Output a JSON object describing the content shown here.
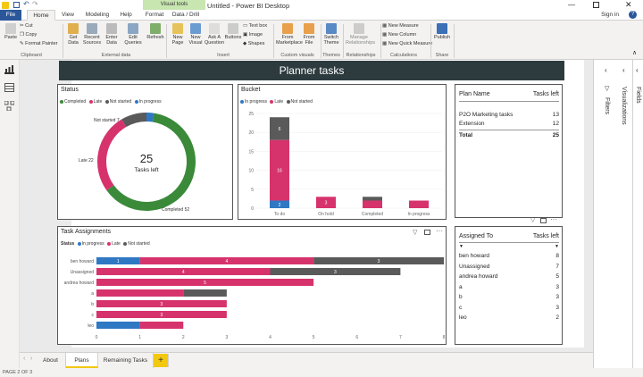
{
  "window": {
    "title": "Untitled - Power BI Desktop",
    "context_tab": "Visual tools",
    "sign_in": "Sign in"
  },
  "tabs": [
    "File",
    "Home",
    "View",
    "Modeling",
    "Help",
    "Format",
    "Data / Drill"
  ],
  "ribbon": {
    "clipboard": {
      "paste": "Paste",
      "cut": "Cut",
      "copy": "Copy",
      "format_painter": "Format Painter",
      "group": "Clipboard"
    },
    "external": {
      "get_data": "Get Data",
      "recent_sources": "Recent Sources",
      "enter_data": "Enter Data",
      "edit_queries": "Edit Queries",
      "refresh": "Refresh",
      "group": "External data"
    },
    "insert": {
      "new_page": "New Page",
      "new_visual": "New Visual",
      "ask": "Ask A Question",
      "buttons": "Buttons",
      "text_box": "Text box",
      "image": "Image",
      "shapes": "Shapes",
      "group": "Insert"
    },
    "custom": {
      "marketplace": "From Marketplace",
      "file": "From File",
      "group": "Custom visuals"
    },
    "themes": {
      "switch": "Switch Theme",
      "group": "Themes"
    },
    "relationships": {
      "manage": "Manage Relationships",
      "group": "Relationships"
    },
    "calculations": {
      "measure": "New Measure",
      "column": "New Column",
      "quick": "New Quick Measure",
      "group": "Calculations"
    },
    "share": {
      "publish": "Publish",
      "group": "Share"
    }
  },
  "report": {
    "title": "Planner tasks"
  },
  "status_chart": {
    "title": "Status",
    "legend": [
      {
        "name": "Completed",
        "color": "#3a8a3a"
      },
      {
        "name": "Late",
        "color": "#d6336c"
      },
      {
        "name": "Not started",
        "color": "#5a5a5a"
      },
      {
        "name": "In progress",
        "color": "#2f78c4"
      }
    ],
    "center_value": "25",
    "center_label": "Tasks left",
    "labels": {
      "not_started": "Not started 7",
      "late": "Late 22",
      "completed": "Completed 52"
    }
  },
  "bucket_chart": {
    "title": "Bucket",
    "legend": [
      {
        "name": "In progress",
        "color": "#2f78c4"
      },
      {
        "name": "Late",
        "color": "#d6336c"
      },
      {
        "name": "Not started",
        "color": "#5a5a5a"
      }
    ]
  },
  "assign_chart": {
    "title": "Task Assignments",
    "legend_prefix": "Status",
    "legend": [
      {
        "name": "In progress",
        "color": "#2f78c4"
      },
      {
        "name": "Late",
        "color": "#d6336c"
      },
      {
        "name": "Not started",
        "color": "#5a5a5a"
      }
    ]
  },
  "chart_data": [
    {
      "type": "pie",
      "title": "Status",
      "categories": [
        "Completed",
        "Late",
        "Not started",
        "In progress"
      ],
      "values": [
        52,
        22,
        7,
        2
      ],
      "colors": [
        "#3a8a3a",
        "#d6336c",
        "#5a5a5a",
        "#2f78c4"
      ]
    },
    {
      "type": "bar",
      "title": "Bucket",
      "stacked": true,
      "categories": [
        "To do",
        "On hold",
        "Completed",
        "In progress"
      ],
      "series": [
        {
          "name": "In progress",
          "values": [
            2,
            0,
            0,
            0
          ],
          "color": "#2f78c4"
        },
        {
          "name": "Late",
          "values": [
            16,
            3,
            2,
            2
          ],
          "color": "#d6336c"
        },
        {
          "name": "Not started",
          "values": [
            6,
            0,
            1,
            0
          ],
          "color": "#5a5a5a"
        }
      ],
      "ylim": [
        0,
        25
      ],
      "yticks": [
        0,
        5,
        10,
        15,
        20,
        25
      ],
      "segment_labels": [
        [
          "2",
          "16",
          "6"
        ],
        [
          "",
          "3",
          ""
        ],
        [
          "",
          "",
          ""
        ],
        [
          "",
          "",
          ""
        ]
      ]
    },
    {
      "type": "bar",
      "orientation": "horizontal",
      "stacked": true,
      "title": "Task Assignments",
      "categories": [
        "ben howard",
        "Unassigned",
        "andrea howard",
        "a",
        "b",
        "c",
        "leo"
      ],
      "series": [
        {
          "name": "In progress",
          "values": [
            1,
            0,
            0,
            0,
            0,
            0,
            1
          ],
          "color": "#2f78c4"
        },
        {
          "name": "Late",
          "values": [
            4,
            4,
            5,
            2,
            3,
            3,
            1
          ],
          "color": "#d6336c"
        },
        {
          "name": "Not started",
          "values": [
            3,
            3,
            0,
            1,
            0,
            0,
            0
          ],
          "color": "#5a5a5a"
        }
      ],
      "segment_labels": [
        [
          "1",
          "4",
          "3"
        ],
        [
          "",
          "4",
          "3"
        ],
        [
          "",
          "5",
          ""
        ],
        [
          "",
          "",
          ""
        ],
        [
          "",
          "3",
          ""
        ],
        [
          "",
          "3",
          ""
        ],
        [
          "",
          "",
          ""
        ]
      ],
      "xlim": [
        0,
        8
      ],
      "xticks": [
        0,
        1,
        2,
        3,
        4,
        5,
        6,
        7,
        8
      ]
    }
  ],
  "plan_table": {
    "headers": [
      "Plan Name",
      "Tasks left"
    ],
    "rows": [
      [
        "P2O Marketing tasks",
        "13"
      ],
      [
        "Extension",
        "12"
      ]
    ],
    "total": [
      "Total",
      "25"
    ]
  },
  "assigned_table": {
    "headers": [
      "Assigned To",
      "Tasks left"
    ],
    "rows": [
      [
        "ben howard",
        "8"
      ],
      [
        "Unassigned",
        "7"
      ],
      [
        "andrea howard",
        "5"
      ],
      [
        "a",
        "3"
      ],
      [
        "b",
        "3"
      ],
      [
        "c",
        "3"
      ],
      [
        "leo",
        "2"
      ]
    ]
  },
  "panes": {
    "visualizations": "Visualizations",
    "filters": "Filters",
    "fields": "Fields"
  },
  "page_tabs": [
    "About",
    "Plans",
    "Remaining Tasks"
  ],
  "add_page": "+",
  "status_bar": "PAGE 2 OF 3"
}
